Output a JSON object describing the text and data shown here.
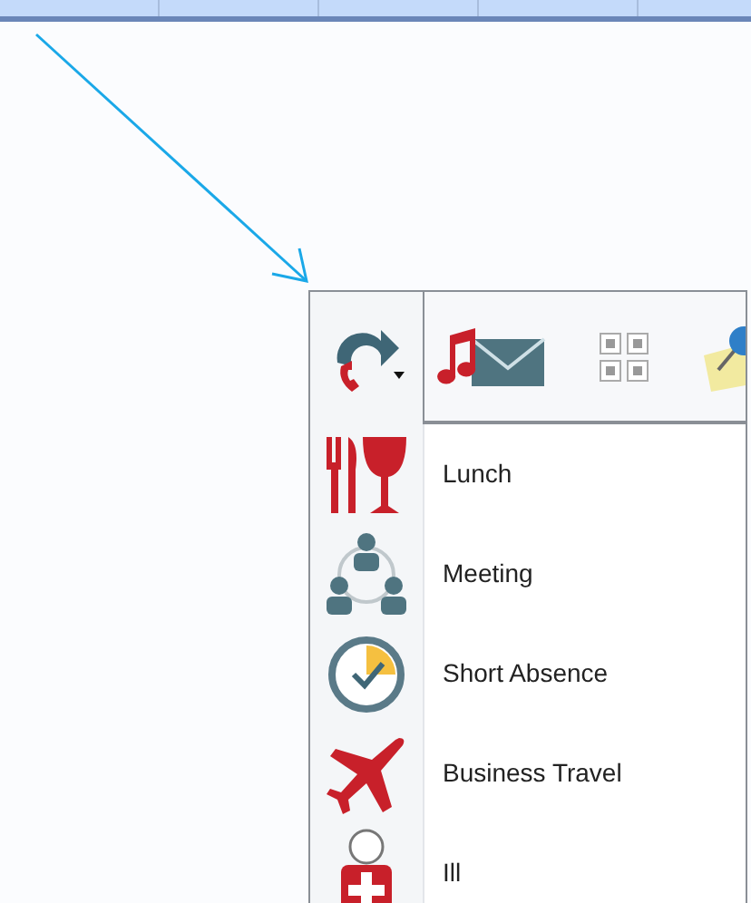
{
  "menu": {
    "items": [
      {
        "label": "Lunch"
      },
      {
        "label": "Meeting"
      },
      {
        "label": "Short Absence"
      },
      {
        "label": "Business Travel"
      },
      {
        "label": "Ill"
      }
    ]
  }
}
